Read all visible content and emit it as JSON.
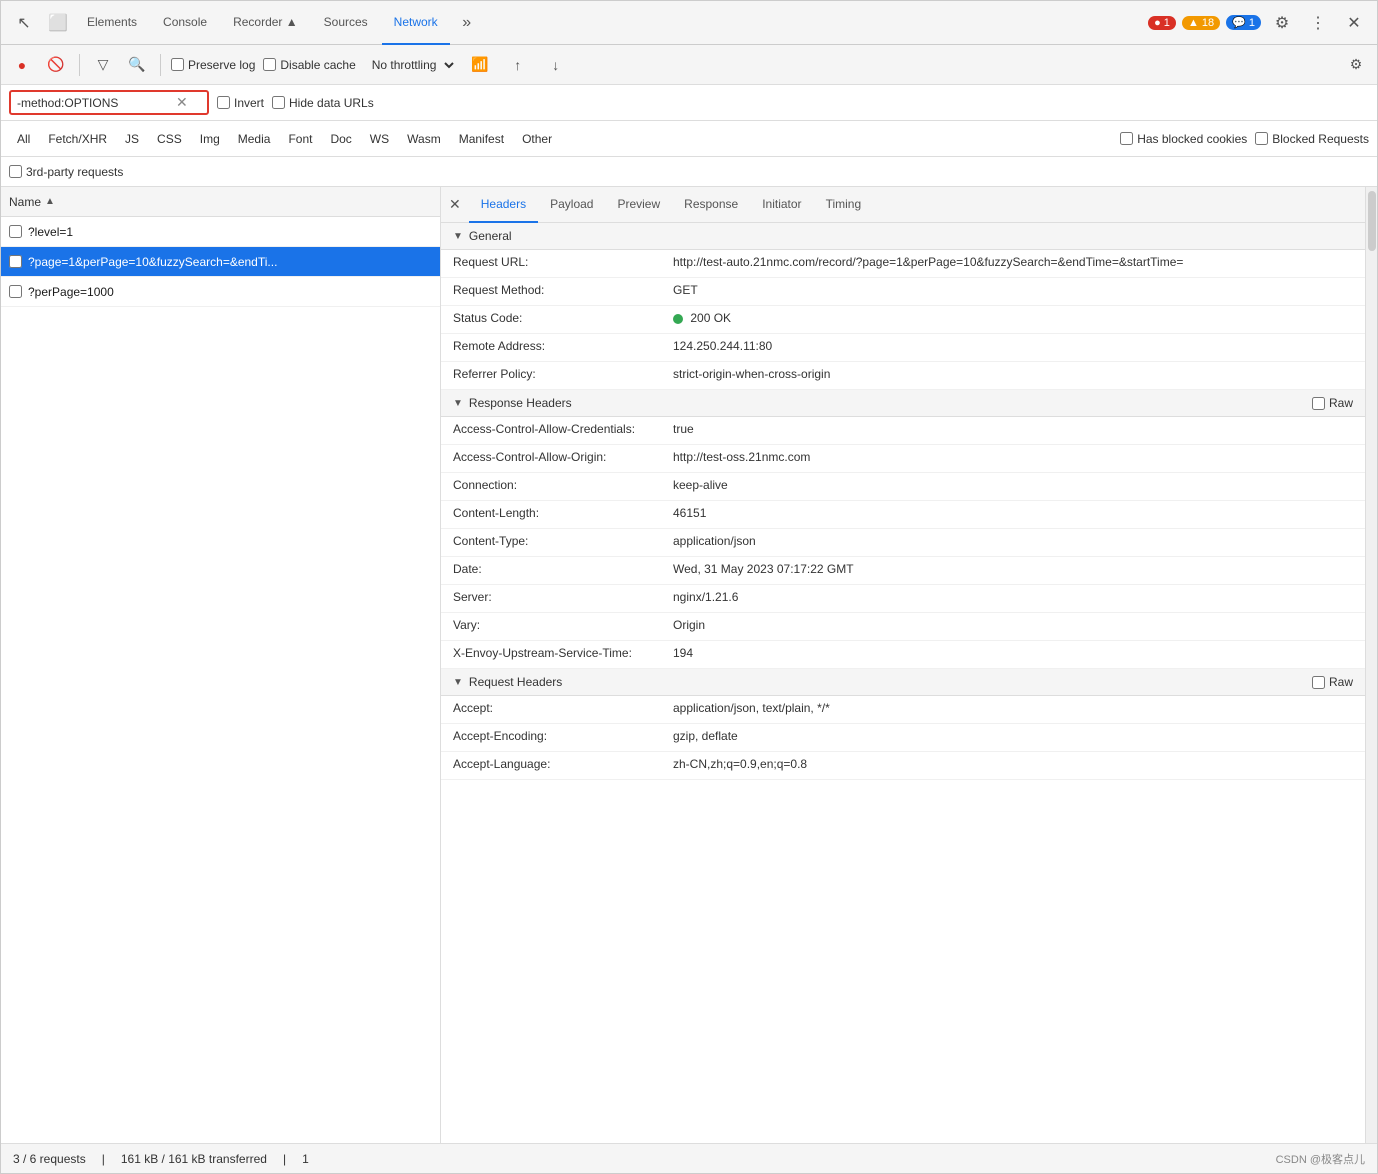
{
  "tabs": {
    "items": [
      {
        "label": "Elements",
        "active": false
      },
      {
        "label": "Console",
        "active": false
      },
      {
        "label": "Recorder ▲",
        "active": false
      },
      {
        "label": "Sources",
        "active": false
      },
      {
        "label": "Network",
        "active": true
      },
      {
        "label": "»",
        "active": false
      }
    ],
    "badges": {
      "error": "● 1",
      "warning": "▲ 18",
      "info": "💬 1"
    }
  },
  "toolbar": {
    "record_label": "●",
    "clear_label": "🚫",
    "filter_label": "▽",
    "search_label": "🔍",
    "preserve_log": "Preserve log",
    "disable_cache": "Disable cache",
    "throttle": "No throttling",
    "settings_label": "⚙"
  },
  "filter": {
    "value": "-method:OPTIONS",
    "invert_label": "Invert",
    "hide_data_urls_label": "Hide data URLs"
  },
  "filter_tabs": [
    {
      "label": "All",
      "active": true
    },
    {
      "label": "Fetch/XHR"
    },
    {
      "label": "JS"
    },
    {
      "label": "CSS"
    },
    {
      "label": "Img"
    },
    {
      "label": "Media"
    },
    {
      "label": "Font"
    },
    {
      "label": "Doc"
    },
    {
      "label": "WS"
    },
    {
      "label": "Wasm"
    },
    {
      "label": "Manifest"
    },
    {
      "label": "Other"
    }
  ],
  "filter_right": {
    "has_blocked_cookies": "Has blocked cookies",
    "blocked_requests": "Blocked Requests"
  },
  "third_party": {
    "label": "3rd-party requests"
  },
  "request_list": {
    "col_name": "Name",
    "items": [
      {
        "name": "?level=1",
        "selected": false
      },
      {
        "name": "?page=1&perPage=10&fuzzySearch=&endTi...",
        "selected": true
      },
      {
        "name": "?perPage=1000",
        "selected": false
      }
    ]
  },
  "detail_tabs": [
    {
      "label": "Headers",
      "active": true
    },
    {
      "label": "Payload"
    },
    {
      "label": "Preview"
    },
    {
      "label": "Response"
    },
    {
      "label": "Initiator"
    },
    {
      "label": "Timing"
    }
  ],
  "general": {
    "title": "General",
    "rows": [
      {
        "key": "Request URL:",
        "value": "http://test-auto.21nmc.com/record/?page=1&perPage=10&fuzzySearch=&endTime=&startTime="
      },
      {
        "key": "Request Method:",
        "value": "GET"
      },
      {
        "key": "Status Code:",
        "value": "200 OK",
        "has_dot": true
      },
      {
        "key": "Remote Address:",
        "value": "124.250.244.11:80"
      },
      {
        "key": "Referrer Policy:",
        "value": "strict-origin-when-cross-origin"
      }
    ]
  },
  "response_headers": {
    "title": "Response Headers",
    "raw_label": "Raw",
    "rows": [
      {
        "key": "Access-Control-Allow-Credentials:",
        "value": "true"
      },
      {
        "key": "Access-Control-Allow-Origin:",
        "value": "http://test-oss.21nmc.com"
      },
      {
        "key": "Connection:",
        "value": "keep-alive"
      },
      {
        "key": "Content-Length:",
        "value": "46151"
      },
      {
        "key": "Content-Type:",
        "value": "application/json"
      },
      {
        "key": "Date:",
        "value": "Wed, 31 May 2023 07:17:22 GMT"
      },
      {
        "key": "Server:",
        "value": "nginx/1.21.6"
      },
      {
        "key": "Vary:",
        "value": "Origin"
      },
      {
        "key": "X-Envoy-Upstream-Service-Time:",
        "value": "194"
      }
    ]
  },
  "request_headers": {
    "title": "Request Headers",
    "raw_label": "Raw",
    "rows": [
      {
        "key": "Accept:",
        "value": "application/json, text/plain, */*"
      },
      {
        "key": "Accept-Encoding:",
        "value": "gzip, deflate"
      },
      {
        "key": "Accept-Language:",
        "value": "zh-CN,zh;q=0.9,en;q=0.8"
      }
    ]
  },
  "status_bar": {
    "requests": "3 / 6 requests",
    "transferred": "161 kB / 161 kB transferred",
    "num": "1",
    "watermark": "CSDN @极客点儿"
  }
}
